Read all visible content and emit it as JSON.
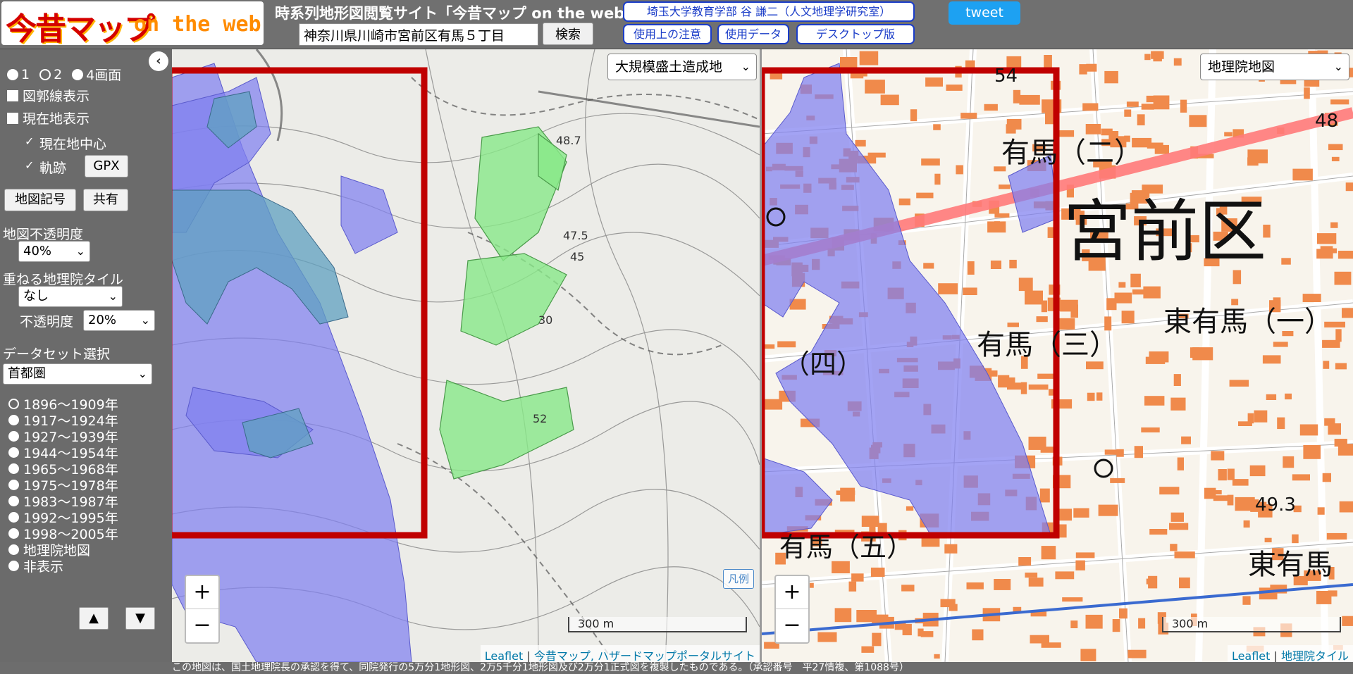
{
  "header": {
    "logo_main": "今昔マップ",
    "logo_sub": "on the web",
    "site_title": "時系列地形図閲覧サイト「今昔マップ on the web」",
    "search_value": "神奈川県川崎市宮前区有馬５丁目",
    "search_button": "検索",
    "author_link": "埼玉大学教育学部 谷 謙二（人文地理学研究室）",
    "notes_link": "使用上の注意",
    "data_link": "使用データ",
    "desktop_link": "デスクトップ版",
    "tweet": "tweet"
  },
  "sidebar": {
    "collapse": "‹",
    "screen_options": [
      "1",
      "2",
      "4画面"
    ],
    "screen_selected": "2",
    "grid_label": "図郭線表示",
    "location_label": "現在地表示",
    "center_label": "現在地中心",
    "track_label": "軌跡",
    "gpx_button": "GPX",
    "symbols_button": "地図記号",
    "share_button": "共有",
    "opacity_label": "地図不透明度",
    "opacity_value": "40%",
    "overlay_label": "重ねる地理院タイル",
    "overlay_value": "なし",
    "overlay_opacity_label": "不透明度",
    "overlay_opacity_value": "20%",
    "dataset_label": "データセット選択",
    "dataset_value": "首都圏",
    "eras": [
      "1896〜1909年",
      "1917〜1924年",
      "1927〜1939年",
      "1944〜1954年",
      "1965〜1968年",
      "1975〜1978年",
      "1983〜1987年",
      "1992〜1995年",
      "1998〜2005年",
      "地理院地図",
      "非表示"
    ],
    "era_selected": "1896〜1909年",
    "up_button": "▲",
    "down_button": "▼"
  },
  "map_left": {
    "layer_select": "大規模盛土造成地",
    "scale": "300 m",
    "legend_button": "凡例",
    "attrib_leaflet": "Leaflet",
    "attrib_sep": " | ",
    "attrib_source": "今昔マップ, ハザードマップポータルサイト",
    "zoom_in": "+",
    "zoom_out": "−",
    "map_labels": [
      "48.7",
      "47.5",
      "45",
      "30",
      "52"
    ]
  },
  "map_right": {
    "layer_select": "地理院地図",
    "scale": "300 m",
    "attrib_leaflet": "Leaflet",
    "attrib_sep": " | ",
    "attrib_source": "地理院タイル",
    "zoom_in": "+",
    "zoom_out": "−",
    "map_labels": {
      "ward": "宮前区",
      "arima2": "有馬（二）",
      "arima3": "有馬（三）",
      "arima4": "（四）",
      "arima5": "有馬（五）",
      "higashi1": "東有馬（一）",
      "higashi": "東有馬",
      "elev1": "48",
      "elev2": "49.3",
      "elev3": "54"
    }
  },
  "footer": {
    "text": "この地図は、国土地理院長の承認を得て、同院発行の5万分1地形図、2万5千分1地形図及び2万分1正式図を複製したものである。（承認番号　平27情複、第1088号）"
  },
  "colors": {
    "fill_area": "#7f7ff0",
    "valley_area": "#88e888",
    "frame": "#c00000",
    "roads": "#ffffff",
    "buildings": "#f08a4b",
    "tweet": "#1da1f2",
    "link": "#1a3cc8"
  }
}
